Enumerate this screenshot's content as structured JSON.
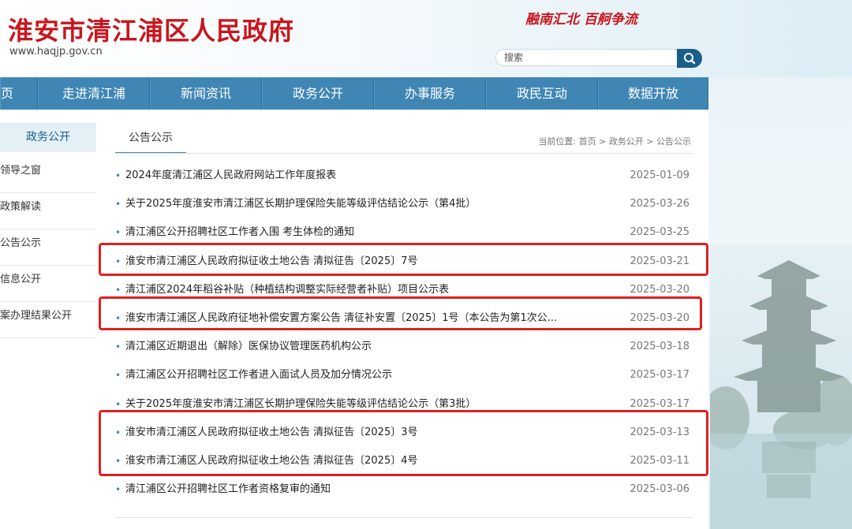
{
  "header": {
    "site_title": "淮安市清江浦区人民政府",
    "site_url": "www.haqjp.gov.cn",
    "slogan": "融南汇北 百舸争流",
    "search_placeholder": "搜索"
  },
  "nav": [
    {
      "label": "页"
    },
    {
      "label": "走进清江浦"
    },
    {
      "label": "新闻资讯"
    },
    {
      "label": "政务公开"
    },
    {
      "label": "办事服务"
    },
    {
      "label": "政民互动"
    },
    {
      "label": "数据开放"
    }
  ],
  "sidebar": {
    "title": "政务公开",
    "items": [
      {
        "label": "领导之窗"
      },
      {
        "label": "政策解读"
      },
      {
        "label": "公告公示"
      },
      {
        "label": "信息公开"
      },
      {
        "label": "案办理结果公开"
      }
    ]
  },
  "main": {
    "tab": "公告公示",
    "breadcrumb": {
      "prefix": "当前位置:",
      "path": "首页 > 政务公开 > 公告公示"
    },
    "rows": [
      {
        "title": "2024年度清江浦区人民政府网站工作年度报表",
        "date": "2025-01-09"
      },
      {
        "title": "关于2025年度淮安市清江浦区长期护理保险失能等级评估结论公示（第4批）",
        "date": "2025-03-26"
      },
      {
        "title": "清江浦区公开招聘社区工作者入围 考生体检的通知",
        "date": "2025-03-25"
      },
      {
        "title": "淮安市清江浦区人民政府拟征收土地公告 清拟征告〔2025〕7号",
        "date": "2025-03-21"
      },
      {
        "title": "清江浦区2024年稻谷补贴（种植结构调整实际经营者补贴）项目公示表",
        "date": "2025-03-20"
      },
      {
        "title": "淮安市清江浦区人民政府征地补偿安置方案公告 清征补安置〔2025〕1号（本公告为第1次公...",
        "date": "2025-03-20"
      },
      {
        "title": "清江浦区近期退出（解除）医保协议管理医药机构公示",
        "date": "2025-03-18"
      },
      {
        "title": "清江浦区公开招聘社区工作者进入面试人员及加分情况公示",
        "date": "2025-03-17"
      },
      {
        "title": "关于2025年度淮安市清江浦区长期护理保险失能等级评估结论公示（第3批）",
        "date": "2025-03-17"
      },
      {
        "title": "淮安市清江浦区人民政府拟征收土地公告 清拟征告〔2025〕3号",
        "date": "2025-03-13"
      },
      {
        "title": "淮安市清江浦区人民政府拟征收土地公告 清拟征告〔2025〕4号",
        "date": "2025-03-11"
      },
      {
        "title": "清江浦区公开招聘社区工作者资格复审的通知",
        "date": "2025-03-06"
      }
    ]
  },
  "colors": {
    "brand_red": "#c8161d",
    "nav_blue": "#3f86b4",
    "highlight_red": "#e02020"
  }
}
